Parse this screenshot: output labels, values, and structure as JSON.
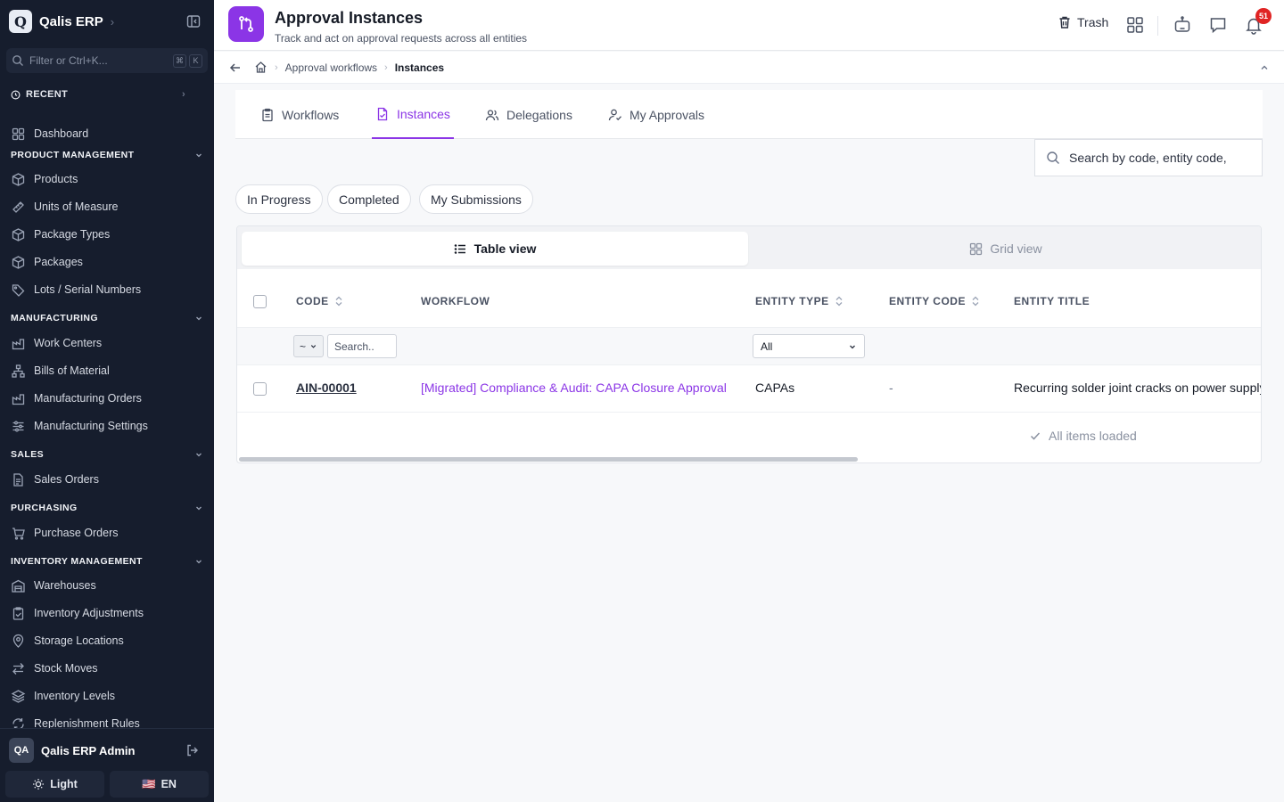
{
  "sidebar": {
    "brand": {
      "logo_letter": "Q",
      "name": "Qalis ERP"
    },
    "filter_placeholder": "Filter or Ctrl+K...",
    "filter_keys": [
      "⌘",
      "K"
    ],
    "recent_label": "RECENT",
    "dashboard": "Dashboard",
    "sections": {
      "product": {
        "title": "PRODUCT MANAGEMENT",
        "items": [
          "Products",
          "Units of Measure",
          "Package Types",
          "Packages",
          "Lots / Serial Numbers"
        ]
      },
      "manufacturing": {
        "title": "MANUFACTURING",
        "items": [
          "Work Centers",
          "Bills of Material",
          "Manufacturing Orders",
          "Manufacturing Settings"
        ]
      },
      "sales": {
        "title": "SALES",
        "items": [
          "Sales Orders"
        ]
      },
      "purchasing": {
        "title": "PURCHASING",
        "items": [
          "Purchase Orders"
        ]
      },
      "inventory": {
        "title": "INVENTORY MANAGEMENT",
        "items": [
          "Warehouses",
          "Inventory Adjustments",
          "Storage Locations",
          "Stock Moves",
          "Inventory Levels",
          "Replenishment Rules"
        ]
      }
    },
    "user": {
      "initials": "QA",
      "name": "Qalis ERP Admin"
    },
    "theme_label": "Light",
    "lang_label": "EN",
    "lang_flag": "🇺🇸"
  },
  "header": {
    "title": "Approval Instances",
    "subtitle": "Track and act on approval requests across all entities",
    "trash_label": "Trash",
    "notification_count": "51",
    "icons": [
      "trash-icon",
      "apps-grid-icon",
      "robot-icon",
      "chat-icon",
      "bell-icon"
    ]
  },
  "breadcrumb": {
    "items": [
      "Approval workflows"
    ],
    "current": "Instances"
  },
  "tabs": [
    "Workflows",
    "Instances",
    "Delegations",
    "My Approvals"
  ],
  "active_tab": "Instances",
  "search": {
    "placeholder": "Search by code, entity code,"
  },
  "chips": [
    "In Progress",
    "Completed",
    "My Submissions"
  ],
  "views": {
    "table": "Table view",
    "grid": "Grid view"
  },
  "table": {
    "columns": [
      "CODE",
      "WORKFLOW",
      "ENTITY TYPE",
      "ENTITY CODE",
      "ENTITY TITLE"
    ],
    "filters": {
      "operator": "~",
      "code_placeholder": "Search..",
      "entity_type": "All"
    },
    "rows": [
      {
        "code": "AIN-00001",
        "workflow": "[Migrated] Compliance & Audit: CAPA Closure Approval",
        "entity_type": "CAPAs",
        "entity_code": "-",
        "entity_title": "Recurring solder joint cracks on power supply"
      }
    ],
    "footer": "All items loaded"
  },
  "colors": {
    "accent": "#8b35e6",
    "sidebar_bg": "#161d2d",
    "badge": "#e02424"
  }
}
